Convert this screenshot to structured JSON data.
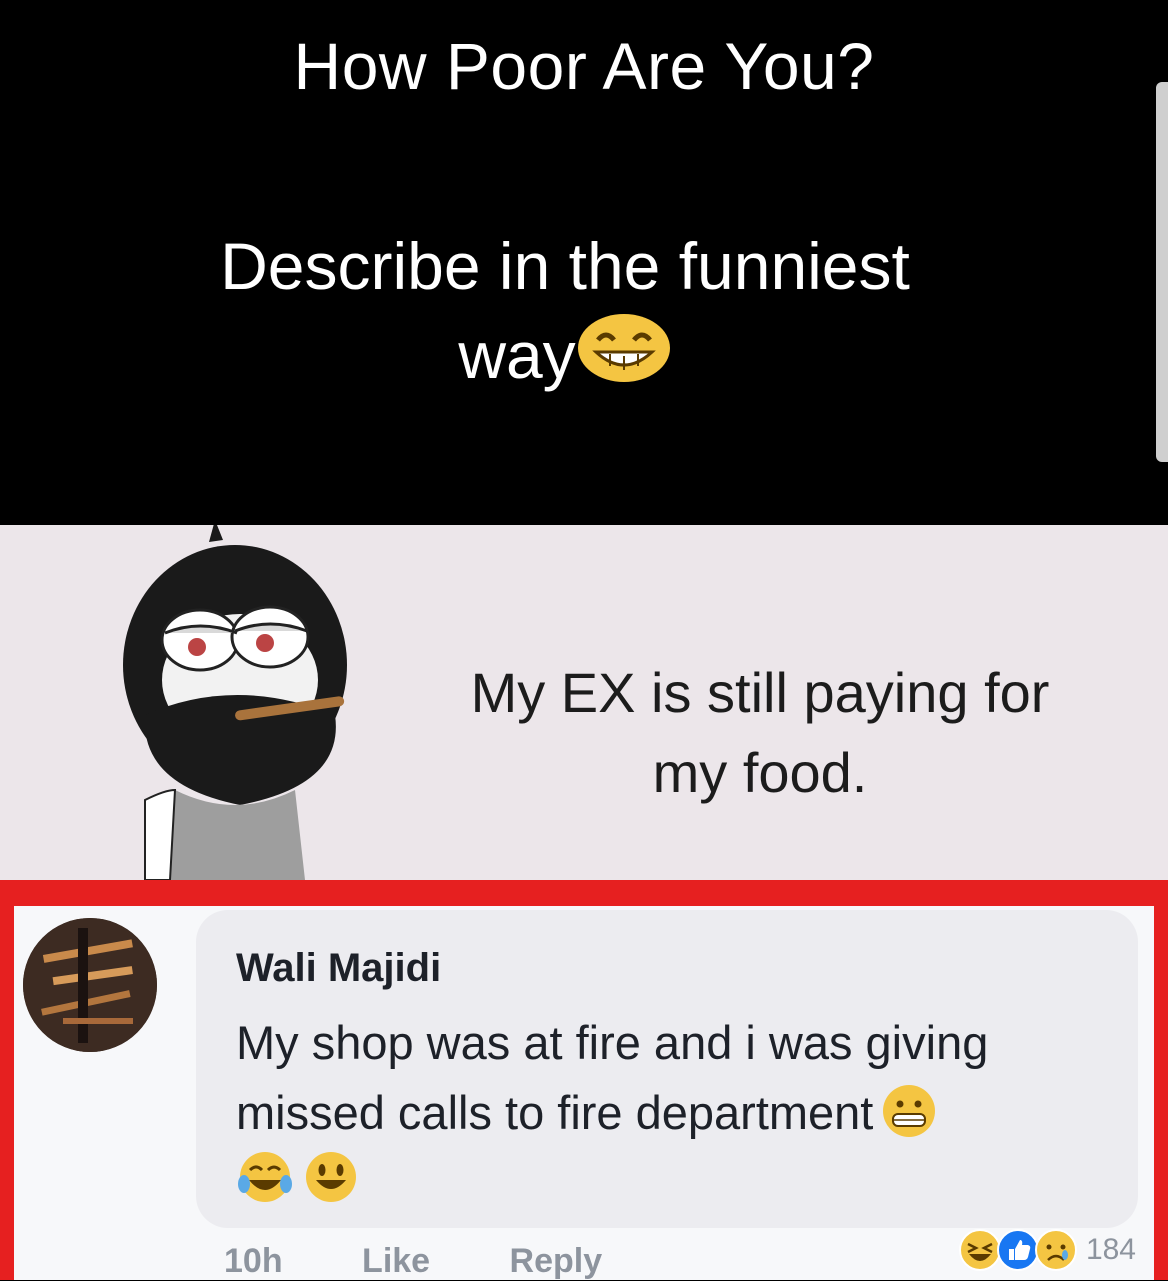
{
  "header": {
    "title": "How Poor Are You?",
    "question_line1": "Describe in the funniest",
    "question_line2": "way",
    "title_emoji": "grinning-squinting-face-icon"
  },
  "meme": {
    "caption_line1": "My EX is still paying for",
    "caption_line2": "my food.",
    "image": "bearded-cartoon-character-smoking"
  },
  "comment": {
    "author": "Wali Majidi",
    "text_line1": "My shop was at fire and i was giving",
    "text_line2": "missed calls to fire department",
    "inline_emoji": "grimacing-face-icon",
    "trailing_emojis": [
      "tears-of-joy-icon",
      "smiling-face-icon"
    ],
    "time": "10h",
    "like_label": "Like",
    "reply_label": "Reply",
    "reaction_icons": [
      "haha-reaction-icon",
      "like-reaction-icon",
      "sad-reaction-icon"
    ],
    "reaction_count": "184",
    "highlight_color": "#e62020"
  }
}
